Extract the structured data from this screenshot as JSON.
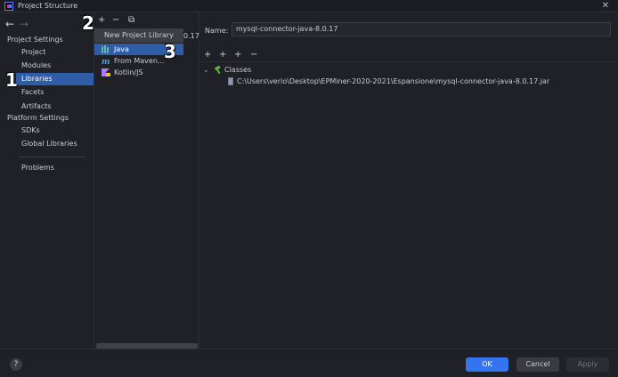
{
  "window": {
    "title": "Project Structure",
    "close_glyph": "✕"
  },
  "nav": {
    "back": "←",
    "forward": "→",
    "sections": [
      {
        "label": "Project Settings"
      },
      {
        "label": "Platform Settings"
      }
    ],
    "items": [
      {
        "label": "Project"
      },
      {
        "label": "Modules"
      },
      {
        "label": "Libraries",
        "selected": true
      },
      {
        "label": "Facets"
      },
      {
        "label": "Artifacts"
      },
      {
        "label": "SDKs"
      },
      {
        "label": "Global Libraries"
      },
      {
        "label": "Problems"
      }
    ]
  },
  "middle": {
    "toolbar": {
      "add": "+",
      "remove": "−",
      "copy": "⧉"
    },
    "tooltip": "New Project Library",
    "truncated_suffix": "0.17",
    "popup_items": [
      {
        "label": "Java",
        "icon": "library-icon",
        "selected": true
      },
      {
        "label": "From Maven...",
        "icon": "maven-icon"
      },
      {
        "label": "Kotlin/JS",
        "icon": "kotlin-icon"
      }
    ]
  },
  "right": {
    "name_label": "Name:",
    "name_value": "mysql-connector-java-8.0.17",
    "toolbar": {
      "add": "+",
      "add_special": "+",
      "add_other": "+",
      "remove": "−"
    },
    "tree": {
      "root": "Classes",
      "child": "C:\\Users\\verio\\Desktop\\EPMiner-2020-2021\\Espansione\\mysql-connector-java-8.0.17.jar"
    }
  },
  "bottom": {
    "help": "?",
    "ok": "OK",
    "cancel": "Cancel",
    "apply": "Apply"
  },
  "annotations": {
    "one": "1",
    "two": "2",
    "three": "3"
  },
  "colors": {
    "selection": "#2e5ca6",
    "accent": "#3574f0",
    "background": "#1f2126"
  }
}
